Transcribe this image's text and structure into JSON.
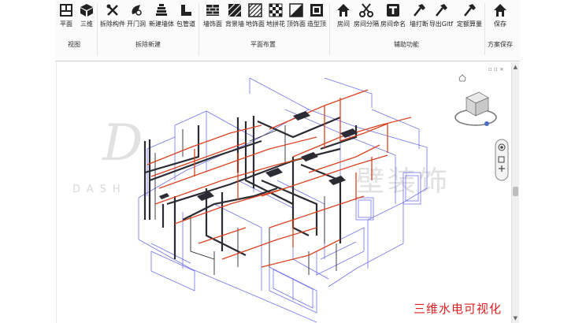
{
  "toolbar": {
    "groups": {
      "view": "视图",
      "demolish": "拆除新建",
      "layout": "平面布置",
      "aux": "辅助功能",
      "save": "方案保存"
    },
    "tools": {
      "plan": "平面",
      "three_d": "三维",
      "demolish_component": "拆除构件",
      "open_door": "开门洞",
      "new_wall": "新建墙体",
      "pipe_wrap": "包管道",
      "wall_finish": "墙饰面",
      "back_wall": "背景墙",
      "floor_finish": "地饰面",
      "floor_pattern": "地拼花",
      "ceiling_finish": "顶饰面",
      "shape_ceiling": "造型顶",
      "room": "房间",
      "room_split": "房间分隔",
      "room_name": "房间命名",
      "wall_break": "墙打断",
      "export_gltf": "导出Gltf",
      "quota": "定额算量",
      "save": "保存"
    }
  },
  "viewport": {
    "caption": "三维水电可视化",
    "watermark_brand": "壁装饰",
    "watermark_latin": "DASH"
  },
  "colors": {
    "wall_line": "#5a5ae8",
    "pipe_dark": "#2b2b33",
    "pipe_red": "#d9421f",
    "caption": "#e02020"
  }
}
